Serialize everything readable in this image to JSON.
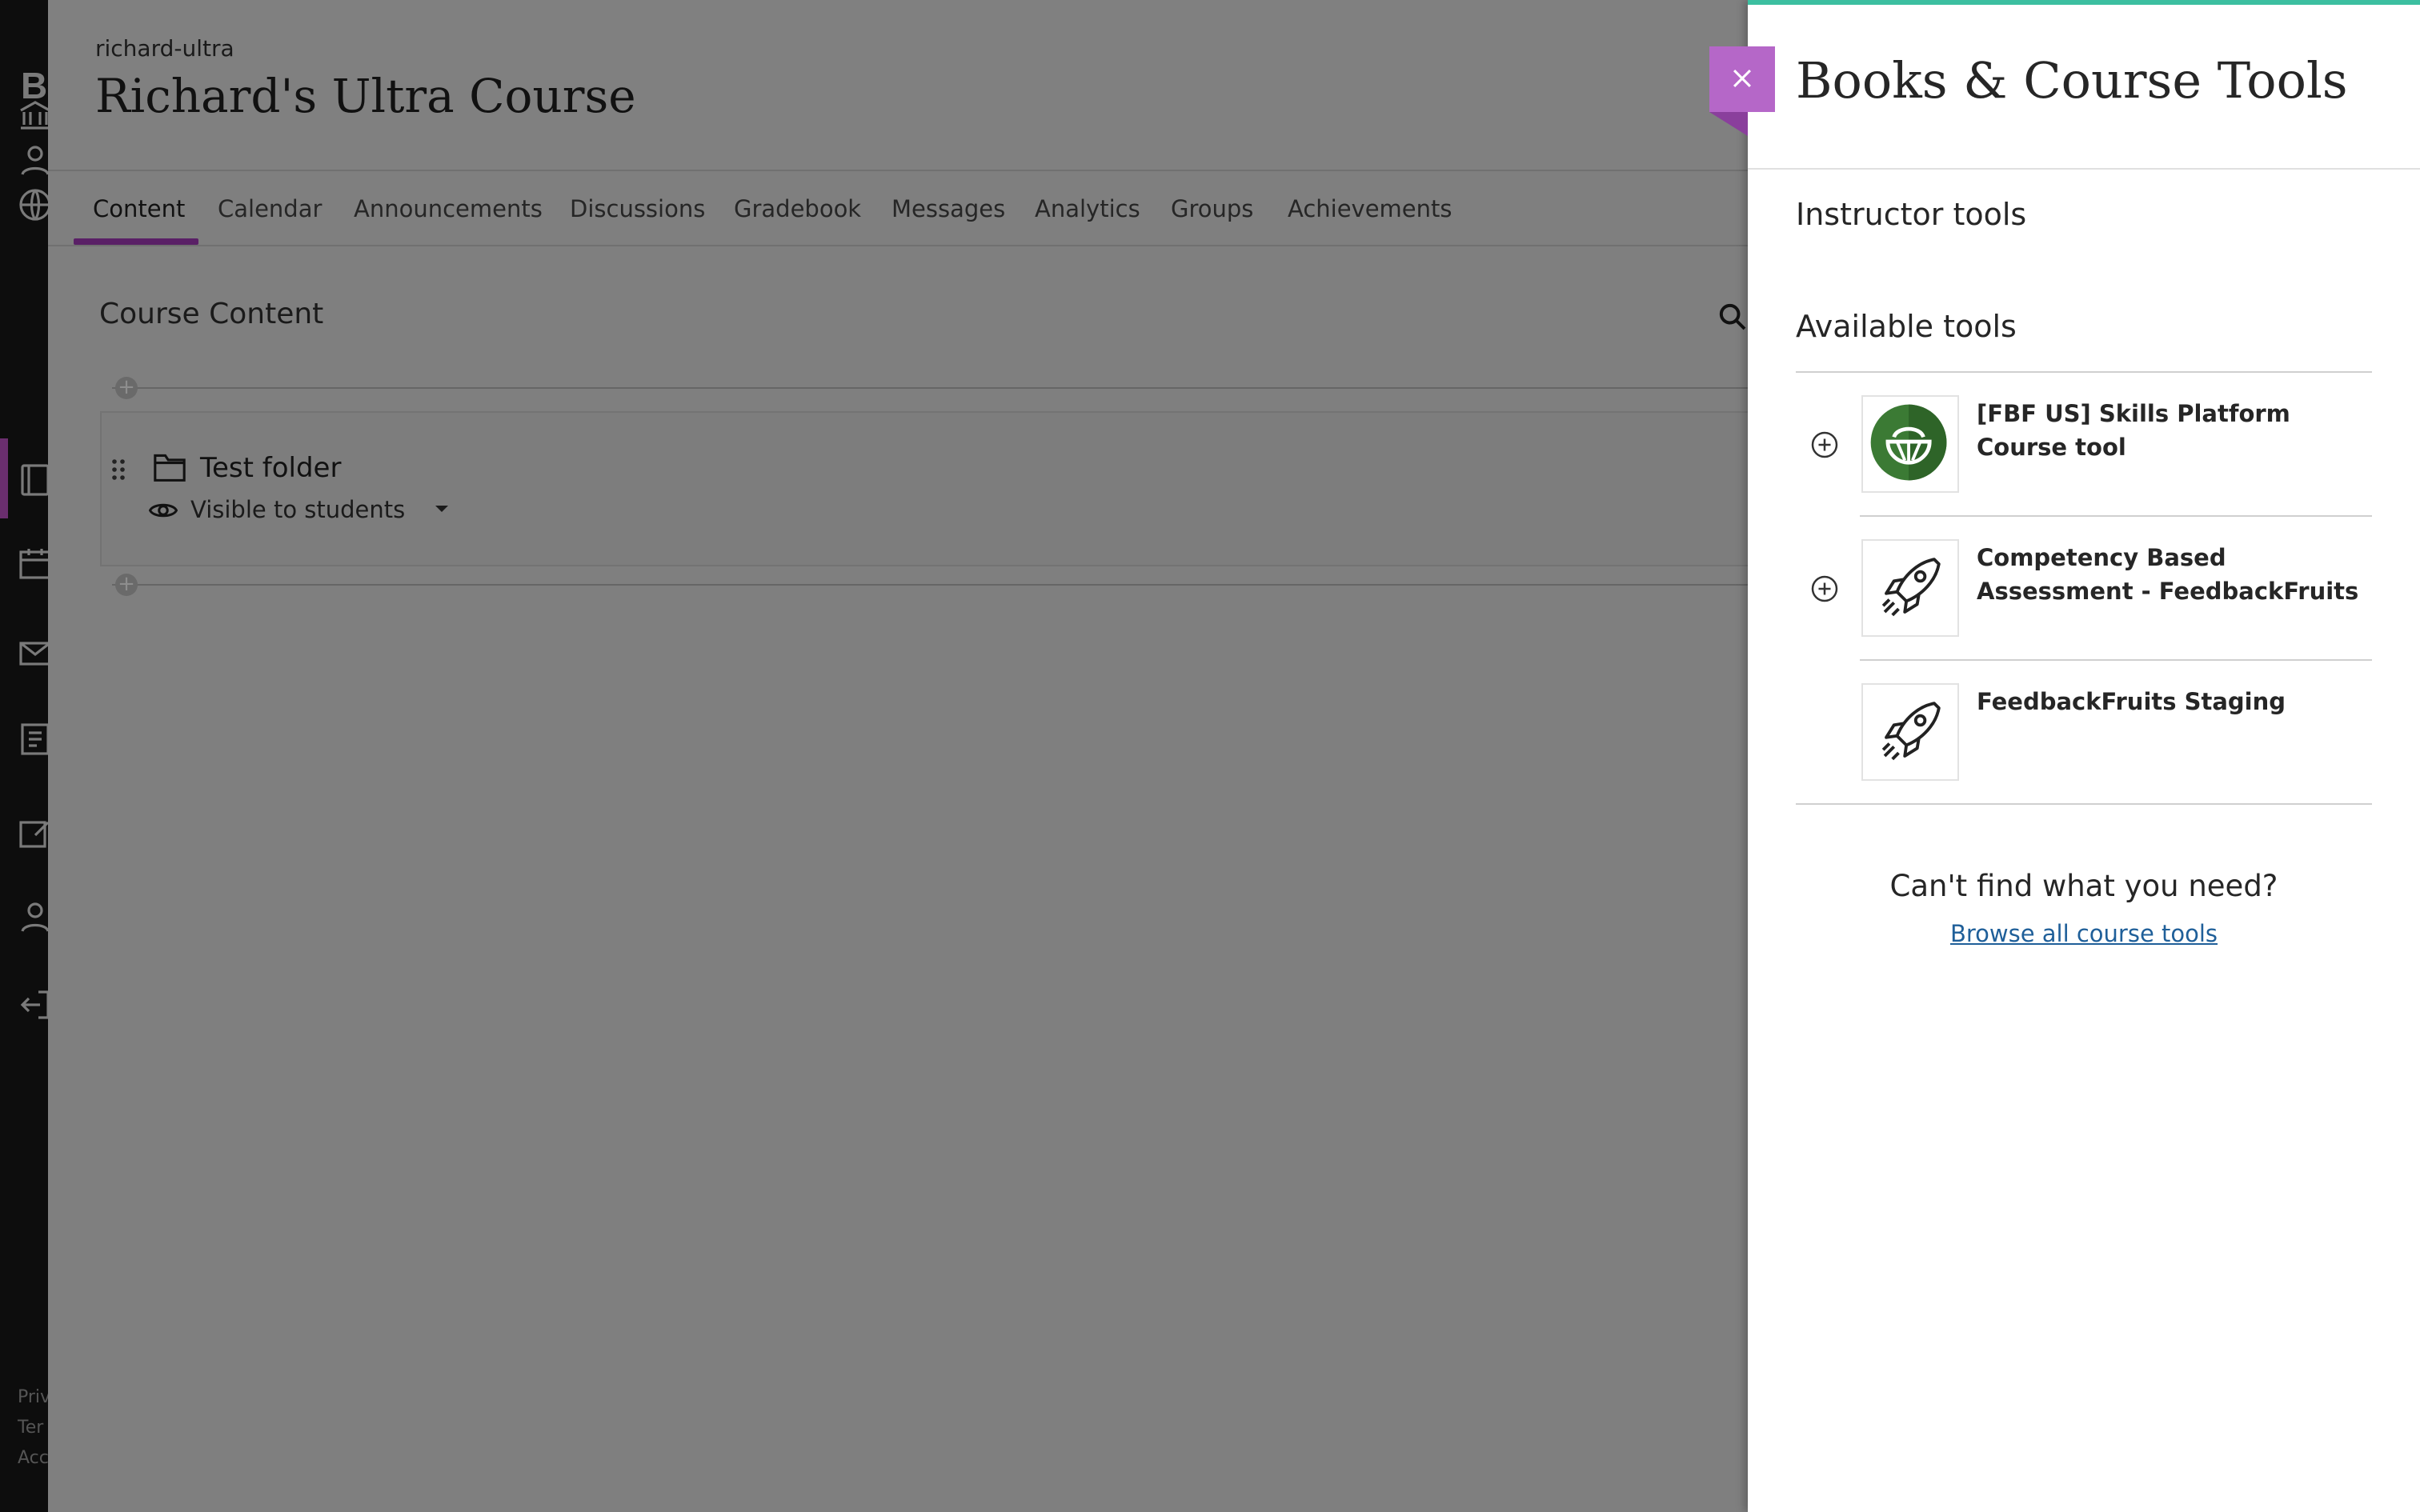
{
  "course": {
    "id": "richard-ultra",
    "title": "Richard's Ultra Course",
    "tabs": [
      "Content",
      "Calendar",
      "Announcements",
      "Discussions",
      "Gradebook",
      "Messages",
      "Analytics",
      "Groups",
      "Achievements"
    ],
    "active_tab": "Content",
    "content_heading": "Course Content",
    "items": [
      {
        "title": "Test folder",
        "type": "folder-icon",
        "visibility": "Visible to students"
      }
    ]
  },
  "left_nav": {
    "brand_letter": "B",
    "icons": [
      "institution-icon",
      "profile-icon",
      "globe-icon",
      "courses-icon",
      "calendar-icon",
      "messages-icon",
      "grades-icon",
      "tools-icon",
      "admin-icon",
      "signout-icon"
    ],
    "footer_fragments": [
      "Priv",
      "Ter",
      "Acc"
    ]
  },
  "panel": {
    "title": "Books & Course Tools",
    "instructor_heading": "Instructor tools",
    "available_heading": "Available tools",
    "tools": [
      {
        "name": "[FBF US] Skills Platform Course tool",
        "icon": "skills-platform-logo-icon",
        "has_add": true
      },
      {
        "name": "Competency Based Assessment - FeedbackFruits",
        "icon": "rocket-icon",
        "has_add": true
      },
      {
        "name": "FeedbackFruits Staging",
        "icon": "rocket-icon",
        "has_add": false
      }
    ],
    "cant_find": "Can't find what you need?",
    "browse_link": "Browse all course tools"
  },
  "colors": {
    "panel_accent": "#3cbfa0",
    "close_button": "#b567c8",
    "tab_underline": "#5a2066",
    "link": "#1f5f99",
    "overlay": "#7f7f7f"
  }
}
